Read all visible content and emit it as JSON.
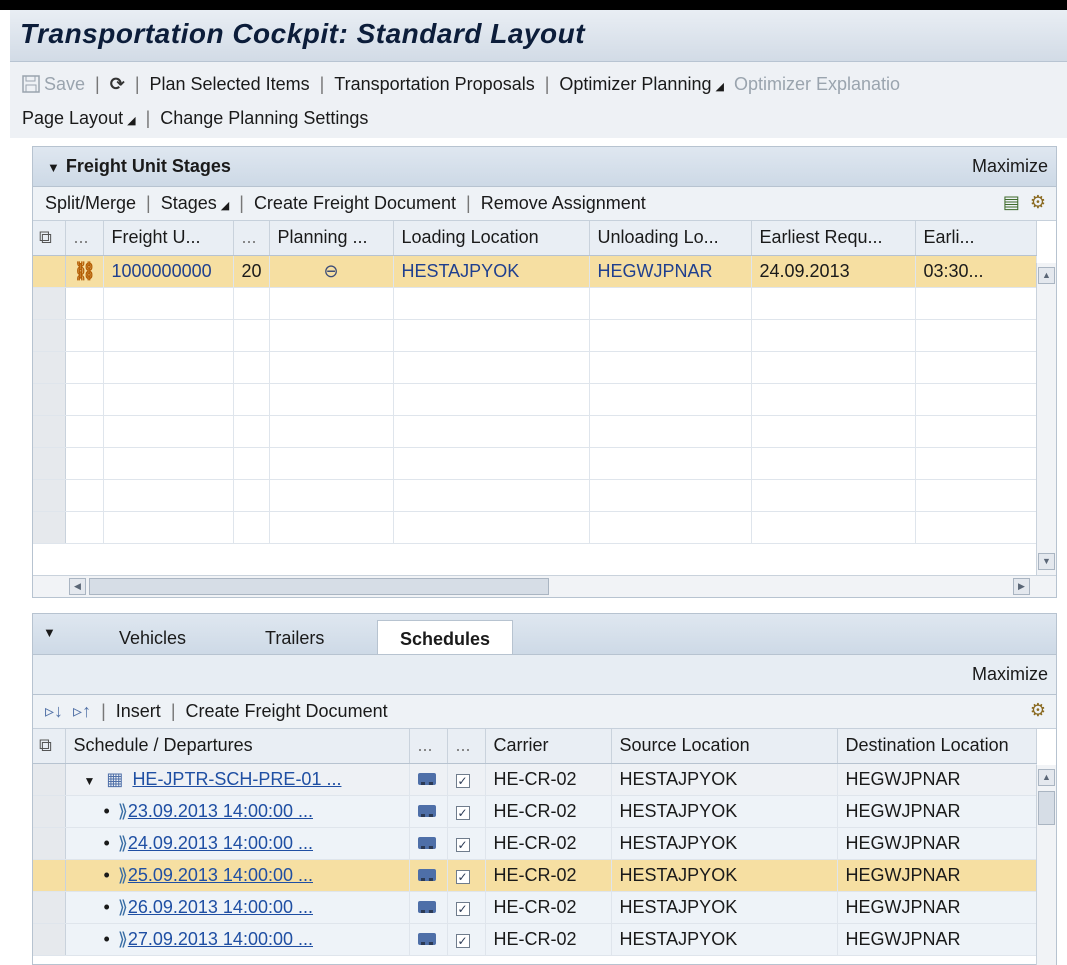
{
  "window": {
    "title": "Transportation Cockpit: Standard Layout"
  },
  "toolbar": {
    "save": "Save",
    "plan_selected": "Plan Selected Items",
    "transport_proposals": "Transportation Proposals",
    "optimizer_planning": "Optimizer Planning",
    "optimizer_explanation": "Optimizer Explanatio",
    "page_layout": "Page Layout",
    "change_settings": "Change Planning Settings"
  },
  "freight_panel": {
    "title": "Freight Unit Stages",
    "maximize": "Maximize",
    "toolbar": {
      "split_merge": "Split/Merge",
      "stages": "Stages",
      "create_freight_doc": "Create Freight Document",
      "remove_assignment": "Remove Assignment"
    },
    "columns": [
      "...",
      "Freight U...",
      "...",
      "Planning ...",
      "Loading Location",
      "Unloading Lo...",
      "Earliest Requ...",
      "Earli..."
    ],
    "rows": [
      {
        "freight_unit": "1000000000",
        "stage": "20",
        "loading": "HESTAJPYOK",
        "unloading": "HEGWJPNAR",
        "earliest_date": "24.09.2013",
        "earliest_time": "03:30..."
      }
    ]
  },
  "bottom_panel": {
    "tabs": [
      "Vehicles",
      "Trailers",
      "Schedules"
    ],
    "maximize": "Maximize",
    "toolbar": {
      "insert": "Insert",
      "create_freight_doc": "Create Freight Document"
    },
    "columns": [
      "Schedule / Departures",
      "...",
      "...",
      "Carrier",
      "Source Location",
      "Destination Location"
    ],
    "rows": [
      {
        "label": "HE-JPTR-SCH-PRE-01 ...",
        "carrier": "HE-CR-02",
        "source": "HESTAJPYOK",
        "dest": "HEGWJPNAR"
      },
      {
        "label": "23.09.2013 14:00:00 ...",
        "carrier": "HE-CR-02",
        "source": "HESTAJPYOK",
        "dest": "HEGWJPNAR"
      },
      {
        "label": "24.09.2013 14:00:00 ...",
        "carrier": "HE-CR-02",
        "source": "HESTAJPYOK",
        "dest": "HEGWJPNAR"
      },
      {
        "label": "25.09.2013 14:00:00 ...",
        "carrier": "HE-CR-02",
        "source": "HESTAJPYOK",
        "dest": "HEGWJPNAR"
      },
      {
        "label": "26.09.2013 14:00:00 ...",
        "carrier": "HE-CR-02",
        "source": "HESTAJPYOK",
        "dest": "HEGWJPNAR"
      },
      {
        "label": "27.09.2013 14:00:00 ...",
        "carrier": "HE-CR-02",
        "source": "HESTAJPYOK",
        "dest": "HEGWJPNAR"
      }
    ]
  }
}
